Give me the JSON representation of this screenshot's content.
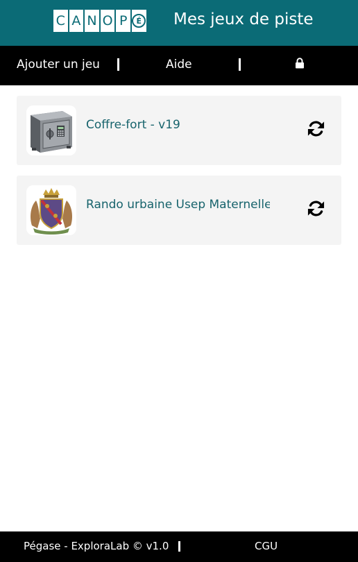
{
  "header": {
    "logo_letters": [
      "C",
      "A",
      "N",
      "O",
      "P",
      "É"
    ],
    "title": "Mes jeux de piste",
    "color": "#0b6b76"
  },
  "nav": {
    "add_game": "Ajouter un jeu",
    "help": "Aide",
    "separator": "|",
    "lock_icon": "lock-icon"
  },
  "games": [
    {
      "title": "Coffre-fort - v19",
      "thumbnail": "safe-image",
      "action_icon": "sync-icon"
    },
    {
      "title": "Rando urbaine Usep Maternelle",
      "thumbnail": "coat-of-arms-image",
      "action_icon": "sync-icon"
    }
  ],
  "footer": {
    "credits": "Pégase - ExploraLab © v1.0",
    "separator": "|",
    "cgu": "CGU"
  },
  "colors": {
    "accent": "#0b6b76",
    "card_title": "#17636c",
    "card_bg": "#f4f4f4",
    "bars": "#000000"
  }
}
